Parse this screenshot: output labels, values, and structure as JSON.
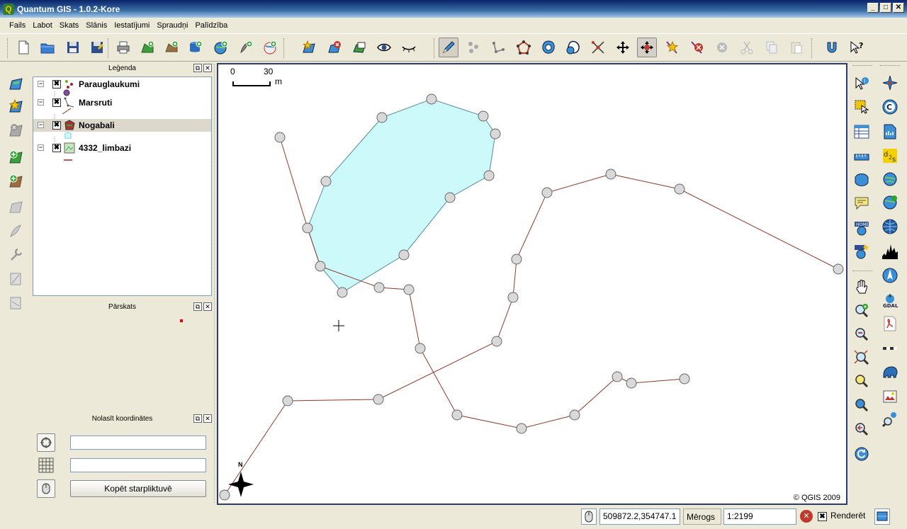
{
  "window": {
    "title": "Quantum GIS - 1.0.2-Kore",
    "app_icon": "Q"
  },
  "menu": [
    "Fails",
    "Labot",
    "Skats",
    "Slānis",
    "Iestatījumi",
    "Spraudņi",
    "Palīdzība"
  ],
  "panels": {
    "legend_title": "Leģenda",
    "overview_title": "Pārskats",
    "coords_title": "Nolasīt koordinātes"
  },
  "layers": [
    {
      "name": "Parauglaukumi",
      "checked": "✖",
      "expander": "−"
    },
    {
      "name": "Marsruti",
      "checked": "✖",
      "expander": "−"
    },
    {
      "name": "Nogabali",
      "checked": "✖",
      "expander": "−",
      "selected": true
    },
    {
      "name": "4332_limbazi",
      "checked": "✖",
      "expander": "−"
    }
  ],
  "coords": {
    "field1": "",
    "field2": "",
    "copy_label": "Kopēt starpliktuvē"
  },
  "map": {
    "scalebar_start": "0",
    "scalebar_end": "30",
    "scalebar_unit": "m",
    "north_label": "N",
    "copyright": "© QGIS 2009",
    "polygon_fill": "#ccf9fa",
    "line_color": "#8b3a2a",
    "vertex_fill": "#d9d9d9"
  },
  "status": {
    "coordinates": "509872.2,354747.1",
    "scale_label": "Mērogs",
    "scale_value": "1:2199",
    "render_label": "Renderēt",
    "render_checked": "✖"
  },
  "window_buttons": {
    "minimize": "_",
    "maximize": "□",
    "close": "✕"
  },
  "dock_buttons": {
    "float": "⧉",
    "close": "✕"
  }
}
